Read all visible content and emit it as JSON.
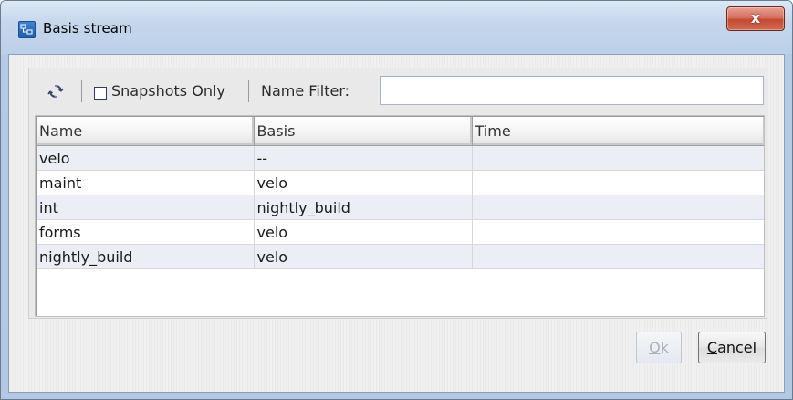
{
  "window": {
    "title": "Basis stream",
    "close_glyph": "x"
  },
  "toolbar": {
    "refresh_icon": "refresh-icon",
    "snapshots_only_label": "Snapshots Only",
    "snapshots_only_checked": false,
    "name_filter_label": "Name Filter:",
    "name_filter_value": ""
  },
  "table": {
    "columns": [
      "Name",
      "Basis",
      "Time"
    ],
    "rows": [
      {
        "name": "velo",
        "basis": "--",
        "time": ""
      },
      {
        "name": "maint",
        "basis": "velo",
        "time": ""
      },
      {
        "name": "int",
        "basis": "nightly_build",
        "time": ""
      },
      {
        "name": "forms",
        "basis": "velo",
        "time": ""
      },
      {
        "name": "nightly_build",
        "basis": "velo",
        "time": ""
      }
    ]
  },
  "buttons": {
    "ok": {
      "mnemonic": "O",
      "rest": "k",
      "enabled": false
    },
    "cancel": {
      "mnemonic": "C",
      "rest": "ancel",
      "enabled": true
    }
  },
  "colors": {
    "title_gradient": "#c6d7ec",
    "close_button": "#c44a33",
    "row_alt": "#ebeef5"
  }
}
